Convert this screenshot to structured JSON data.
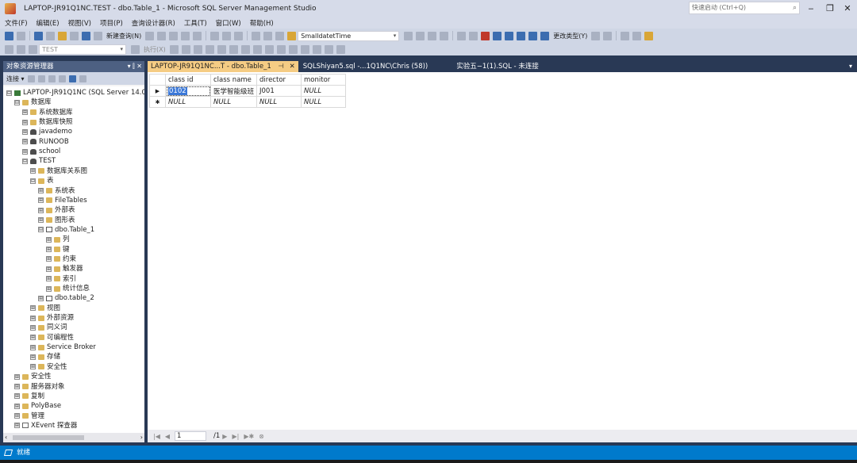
{
  "window": {
    "title": "LAPTOP-JR91Q1NC.TEST - dbo.Table_1 - Microsoft SQL Server Management Studio",
    "quick_launch_placeholder": "快速启动 (Ctrl+Q)",
    "minimize": "‒",
    "maximize": "❐",
    "close": "✕"
  },
  "menu": [
    "文件(F)",
    "编辑(E)",
    "视图(V)",
    "项目(P)",
    "查询设计器(R)",
    "工具(T)",
    "窗口(W)",
    "帮助(H)"
  ],
  "toolbar1": {
    "new_query": "新建查询(N)",
    "type_combo": "SmalldatetTime",
    "change_type": "更改类型(Y)"
  },
  "toolbar2": {
    "db_combo": "TEST",
    "execute": "执行(X)"
  },
  "object_explorer": {
    "title": "对象资源管理器",
    "header_buttons": "▾ ⫿ ✕",
    "connect": "连接 ▾",
    "tree": [
      {
        "label": "LAPTOP-JR91Q1NC (SQL Server 14.0.",
        "level": 0,
        "icon": "server",
        "expander": "⊟"
      },
      {
        "label": "数据库",
        "level": 1,
        "icon": "folder",
        "expander": "⊟"
      },
      {
        "label": "系统数据库",
        "level": 2,
        "icon": "folder",
        "expander": "⊞"
      },
      {
        "label": "数据库快照",
        "level": 2,
        "icon": "folder",
        "expander": "⊞"
      },
      {
        "label": "javademo",
        "level": 2,
        "icon": "db",
        "expander": "⊞"
      },
      {
        "label": "RUNOOB",
        "level": 2,
        "icon": "db",
        "expander": "⊞"
      },
      {
        "label": "school",
        "level": 2,
        "icon": "db",
        "expander": "⊞"
      },
      {
        "label": "TEST",
        "level": 2,
        "icon": "db",
        "expander": "⊟"
      },
      {
        "label": "数据库关系图",
        "level": 3,
        "icon": "folder",
        "expander": "⊞"
      },
      {
        "label": "表",
        "level": 3,
        "icon": "folder",
        "expander": "⊟"
      },
      {
        "label": "系统表",
        "level": 4,
        "icon": "folder",
        "expander": "⊞"
      },
      {
        "label": "FileTables",
        "level": 4,
        "icon": "folder",
        "expander": "⊞"
      },
      {
        "label": "外部表",
        "level": 4,
        "icon": "folder",
        "expander": "⊞"
      },
      {
        "label": "图形表",
        "level": 4,
        "icon": "folder",
        "expander": "⊞"
      },
      {
        "label": "dbo.Table_1",
        "level": 4,
        "icon": "table",
        "expander": "⊟"
      },
      {
        "label": "列",
        "level": 5,
        "icon": "folder",
        "expander": "⊞"
      },
      {
        "label": "键",
        "level": 5,
        "icon": "folder",
        "expander": "⊞"
      },
      {
        "label": "约束",
        "level": 5,
        "icon": "folder",
        "expander": "⊞"
      },
      {
        "label": "触发器",
        "level": 5,
        "icon": "folder",
        "expander": "⊞"
      },
      {
        "label": "索引",
        "level": 5,
        "icon": "folder",
        "expander": "⊞"
      },
      {
        "label": "统计信息",
        "level": 5,
        "icon": "folder",
        "expander": "⊞"
      },
      {
        "label": "dbo.table_2",
        "level": 4,
        "icon": "table",
        "expander": "⊞"
      },
      {
        "label": "视图",
        "level": 3,
        "icon": "folder",
        "expander": "⊞"
      },
      {
        "label": "外部资源",
        "level": 3,
        "icon": "folder",
        "expander": "⊞"
      },
      {
        "label": "同义词",
        "level": 3,
        "icon": "folder",
        "expander": "⊞"
      },
      {
        "label": "可编程性",
        "level": 3,
        "icon": "folder",
        "expander": "⊞"
      },
      {
        "label": "Service Broker",
        "level": 3,
        "icon": "folder",
        "expander": "⊞"
      },
      {
        "label": "存储",
        "level": 3,
        "icon": "folder",
        "expander": "⊞"
      },
      {
        "label": "安全性",
        "level": 3,
        "icon": "folder",
        "expander": "⊞"
      },
      {
        "label": "安全性",
        "level": 1,
        "icon": "folder",
        "expander": "⊞"
      },
      {
        "label": "服务器对象",
        "level": 1,
        "icon": "folder",
        "expander": "⊞"
      },
      {
        "label": "复制",
        "level": 1,
        "icon": "folder",
        "expander": "⊞"
      },
      {
        "label": "PolyBase",
        "level": 1,
        "icon": "folder",
        "expander": "⊞"
      },
      {
        "label": "管理",
        "level": 1,
        "icon": "folder",
        "expander": "⊞"
      },
      {
        "label": "XEvent 探查器",
        "level": 1,
        "icon": "xevent",
        "expander": "⊞"
      }
    ]
  },
  "tabs": [
    {
      "label": "LAPTOP-JR91Q1NC...T - dbo.Table_1",
      "active": true,
      "pin": "⊣",
      "close": "✕"
    },
    {
      "label": "SQLShiyan5.sql -...1Q1NC\\Chris (58))",
      "active": false
    },
    {
      "label": "实验五−1(1).SQL - 未连接",
      "active": false
    }
  ],
  "grid": {
    "columns": [
      "class id",
      "class name",
      "director",
      "monitor"
    ],
    "rows": [
      {
        "marker": "▶",
        "cells": [
          "0102",
          "医学智能级班",
          "J001",
          "NULL"
        ],
        "nulls": [
          false,
          false,
          false,
          true
        ]
      },
      {
        "marker": "✱",
        "cells": [
          "NULL",
          "NULL",
          "NULL",
          "NULL"
        ],
        "nulls": [
          true,
          true,
          true,
          true
        ]
      }
    ]
  },
  "nav": {
    "current": "1",
    "total": "/1"
  },
  "status": {
    "text": "就绪"
  },
  "colors": {
    "accent": "#007acc",
    "active_tab": "#f5cc84",
    "chrome": "#d6dbe9"
  }
}
